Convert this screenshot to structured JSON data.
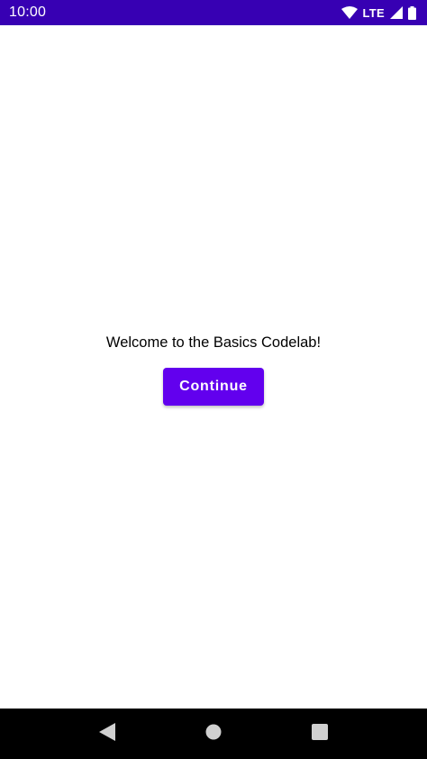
{
  "status_bar": {
    "time": "10:00",
    "network": "LTE",
    "icons": [
      "wifi-icon",
      "cellular-signal-icon",
      "battery-icon"
    ],
    "background": "#3700b3"
  },
  "main": {
    "welcome_text": "Welcome to the Basics Codelab!",
    "continue_label": "Continue",
    "button_color": "#6200ee"
  },
  "nav_bar": {
    "icons": [
      "back-icon",
      "home-icon",
      "recents-icon"
    ]
  }
}
